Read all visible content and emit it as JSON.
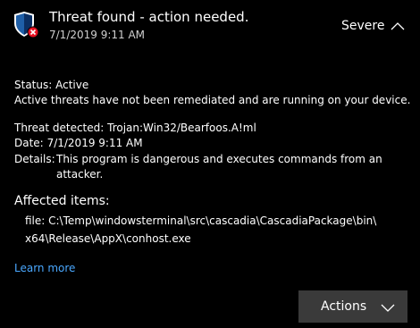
{
  "notification": {
    "title": "Threat found - action needed.",
    "timestamp": "7/1/2019 9:11 AM",
    "severity": "Severe",
    "icon": "shield-error-icon",
    "collapse_icon": "chevron-up-icon"
  },
  "details": {
    "status_label": "Status:",
    "status_value": "Active",
    "status_message": "Active threats have not been remediated and are running on your device.",
    "threat_label": "Threat detected:",
    "threat_value": "Trojan:Win32/Bearfoos.A!ml",
    "date_label": "Date:",
    "date_value": "7/1/2019 9:11 AM",
    "details_label": "Details:",
    "details_value": "This program is dangerous and executes commands from an attacker."
  },
  "affected": {
    "heading": "Affected items:",
    "items": [
      "file: C:\\Temp\\windowsterminal\\src\\cascadia\\CascadiaPackage\\bin\\x64\\Release\\AppX\\conhost.exe"
    ]
  },
  "links": {
    "learn_more": "Learn more"
  },
  "actions": {
    "label": "Actions",
    "icon": "chevron-down-icon"
  },
  "colors": {
    "background": "#000000",
    "link": "#4aa8ff",
    "button": "#3a3a3a",
    "shield": "#1f5fa8",
    "error_badge": "#e81123"
  }
}
